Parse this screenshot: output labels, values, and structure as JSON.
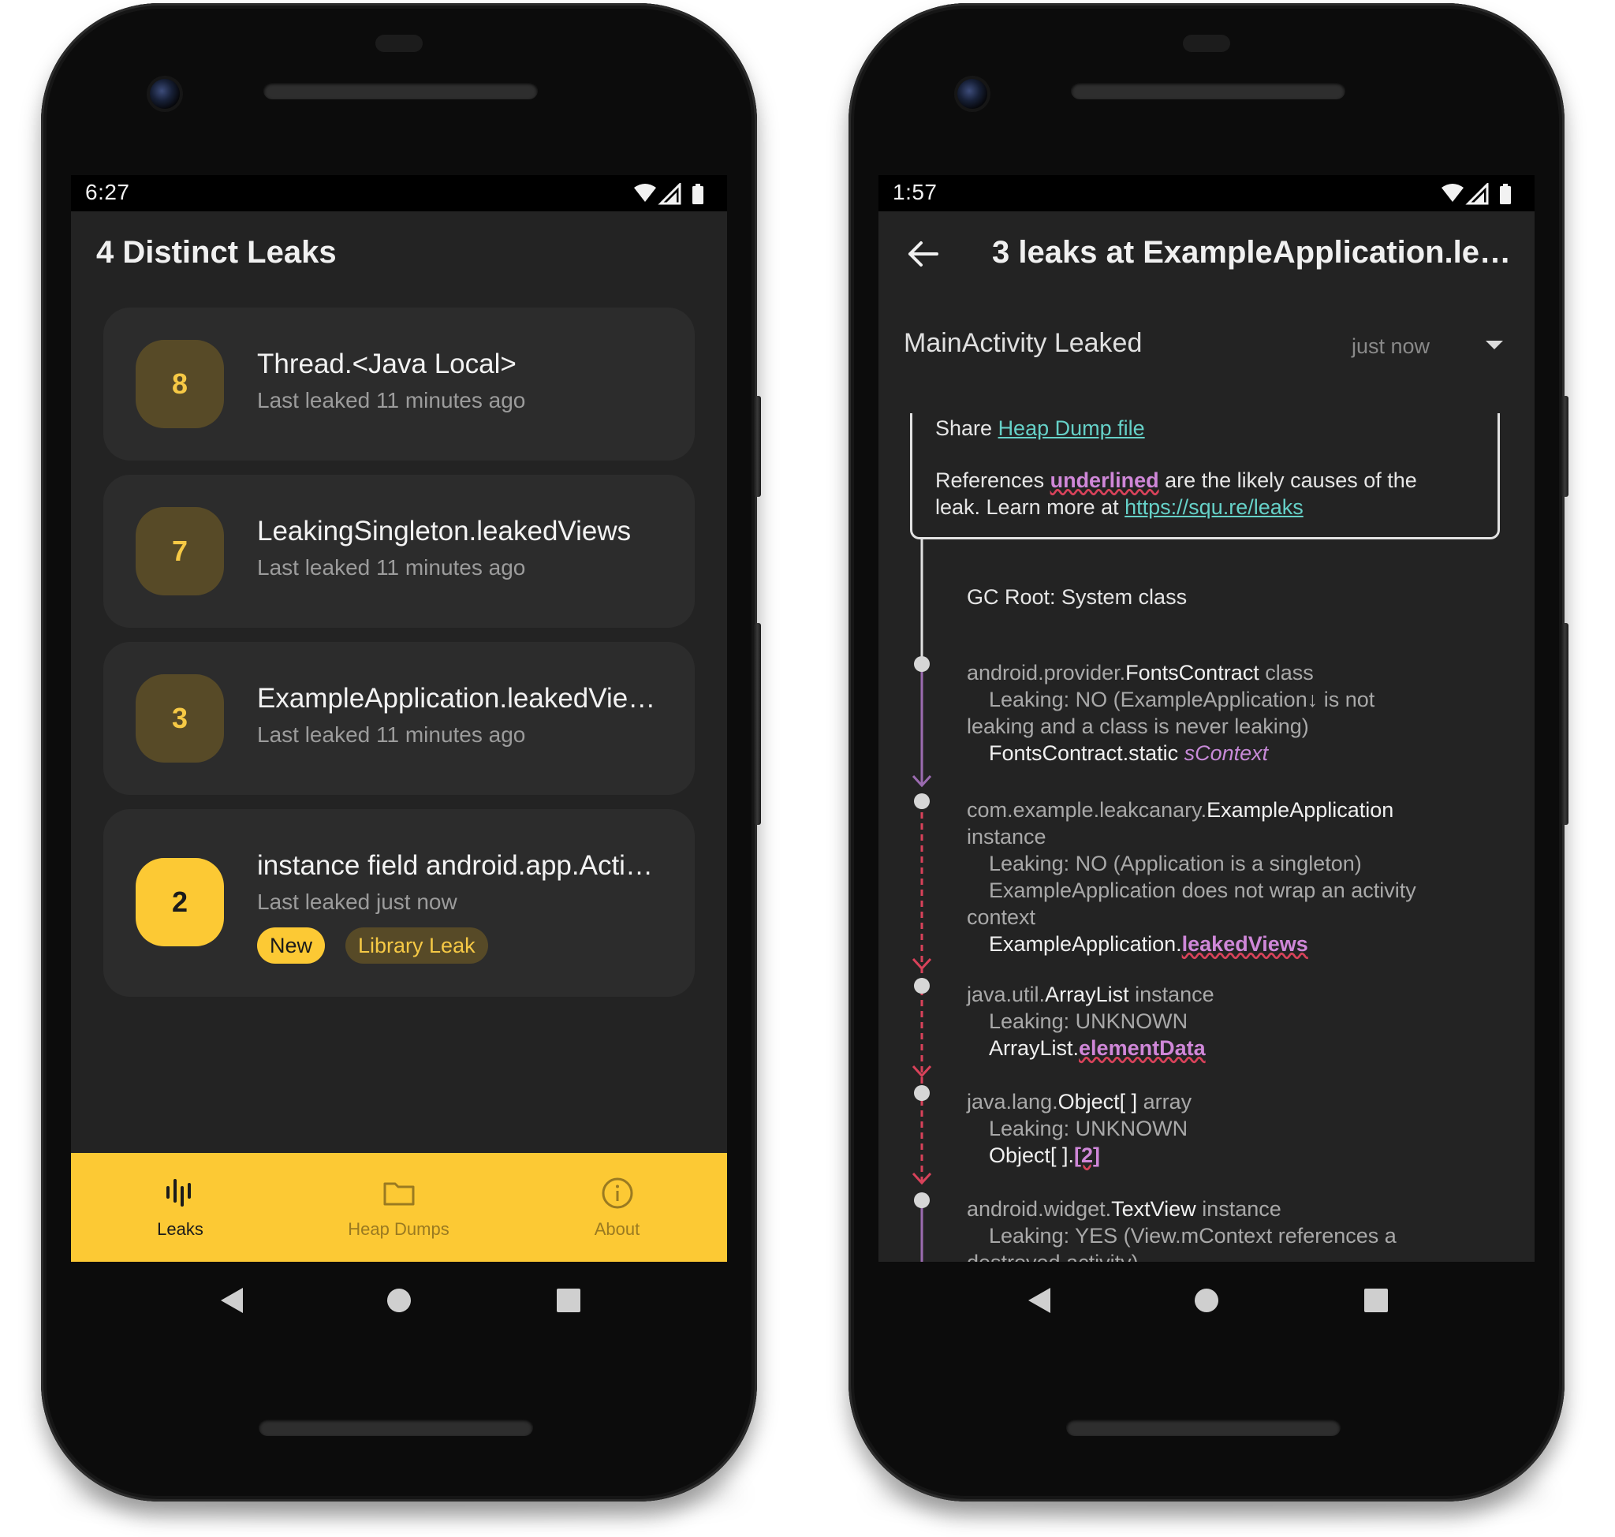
{
  "leaks_screen": {
    "status_time": "6:27",
    "title": "4 Distinct Leaks",
    "leaks": [
      {
        "count": "8",
        "title": "Thread.<Java Local>",
        "subtitle": "Last leaked 11 minutes ago"
      },
      {
        "count": "7",
        "title": "LeakingSingleton.leakedViews",
        "subtitle": "Last leaked 11 minutes ago"
      },
      {
        "count": "3",
        "title": "ExampleApplication.leakedVie…",
        "subtitle": "Last leaked 11 minutes ago"
      },
      {
        "count": "2",
        "title": "instance field android.app.Acti…",
        "subtitle": "Last leaked just now",
        "chips": [
          "New",
          "Library Leak"
        ]
      }
    ],
    "nav": [
      {
        "label": "Leaks",
        "icon": "leaks-icon",
        "active": true
      },
      {
        "label": "Heap Dumps",
        "icon": "folder-icon",
        "active": false
      },
      {
        "label": "About",
        "icon": "info-icon",
        "active": false
      }
    ]
  },
  "trace_screen": {
    "status_time": "1:57",
    "title": "3 leaks at ExampleApplication.le…",
    "section_title": "MainActivity Leaked",
    "section_time": "just now",
    "share_prefix": "Share ",
    "share_link": "Heap Dump file",
    "refs_line1_a": "References ",
    "refs_line1_b": "underlined",
    "refs_line1_c": " are the likely causes of the",
    "refs_line2_a": "leak. Learn more at ",
    "refs_line2_link": "https://squ.re/leaks",
    "gc_root": "GC Root: System class",
    "nodes": [
      {
        "pkg": "android.provider.",
        "cls": "FontsContract",
        "kind": " class",
        "lines": [
          "Leaking: NO (ExampleApplication↓ is not",
          "leaking and a class is never leaking)"
        ],
        "ref_owner": "FontsContract.static ",
        "ref_field": "sContext"
      },
      {
        "pkg": "com.example.leakcanary.",
        "cls": "ExampleApplication",
        "kind_line": "instance",
        "lines": [
          "Leaking: NO (Application is a singleton)",
          "ExampleApplication does not wrap an activity",
          "context"
        ],
        "ref_owner": "ExampleApplication.",
        "ref_field": "leakedViews"
      },
      {
        "pkg": "java.util.",
        "cls": "ArrayList",
        "kind": " instance",
        "lines": [
          "Leaking: UNKNOWN"
        ],
        "ref_owner": "ArrayList.",
        "ref_field": "elementData"
      },
      {
        "pkg": "java.lang.",
        "cls": "Object[ ]",
        "kind": " array",
        "lines": [
          "Leaking: UNKNOWN"
        ],
        "ref_owner": "Object[ ].",
        "ref_field": "[2]"
      },
      {
        "pkg": "android.widget.",
        "cls": "TextView",
        "kind": " instance",
        "lines": [
          "Leaking: YES (View.mContext references a",
          "destroyed activity)"
        ]
      }
    ]
  },
  "colors": {
    "accent": "#fcc934",
    "badge_dim": "#574a27",
    "card": "#2c2c2c",
    "app_bg": "#232323",
    "link": "#66d1c8",
    "leak_ref": "#cf87d8",
    "suspect_line": "#d8425a",
    "trace_line": "#9b6bb0"
  }
}
